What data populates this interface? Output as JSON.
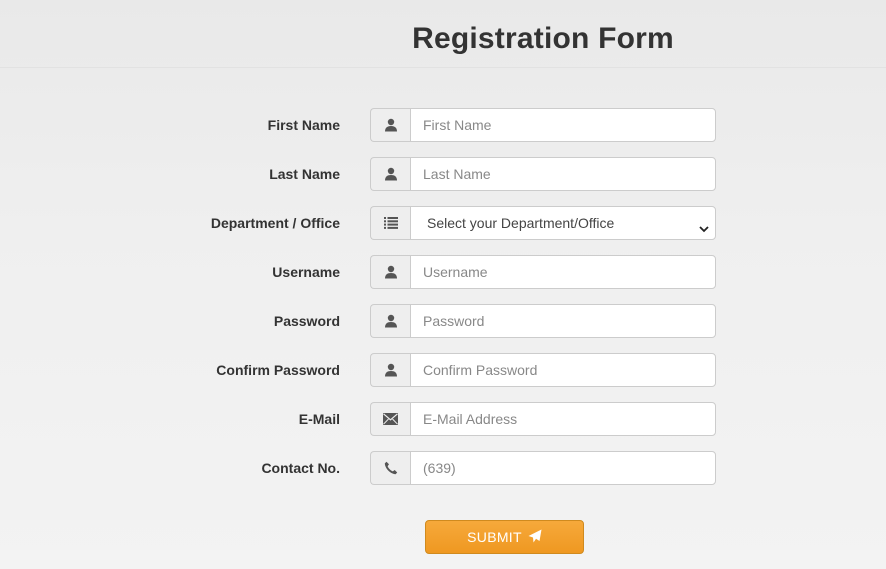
{
  "header": {
    "title": "Registration Form"
  },
  "form": {
    "first_name": {
      "label": "First Name",
      "placeholder": "First Name",
      "icon": "user-icon"
    },
    "last_name": {
      "label": "Last Name",
      "placeholder": "Last Name",
      "icon": "user-icon"
    },
    "department": {
      "label": "Department / Office",
      "selected": "Select your Department/Office",
      "icon": "list-icon"
    },
    "username": {
      "label": "Username",
      "placeholder": "Username",
      "icon": "user-icon"
    },
    "password": {
      "label": "Password",
      "placeholder": "Password",
      "icon": "user-icon"
    },
    "confirm_password": {
      "label": "Confirm Password",
      "placeholder": "Confirm Password",
      "icon": "user-icon"
    },
    "email": {
      "label": "E-Mail",
      "placeholder": "E-Mail Address",
      "icon": "envelope-icon"
    },
    "contact": {
      "label": "Contact No.",
      "placeholder": "(639)",
      "icon": "phone-icon"
    },
    "submit_label": "SUBMIT",
    "submit_icon": "send-icon"
  },
  "colors": {
    "submit_button": "#f0a030",
    "addon_background": "#eeeeee",
    "border": "#cccccc"
  }
}
